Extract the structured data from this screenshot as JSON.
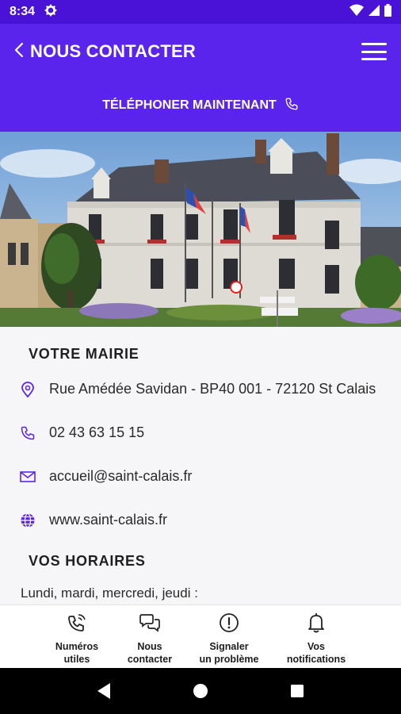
{
  "status_bar": {
    "time": "8:34"
  },
  "header": {
    "title": "NOUS CONTACTER"
  },
  "call_bar": {
    "label": "TÉLÉPHONER MAINTENANT"
  },
  "mairie": {
    "title": "VOTRE MAIRIE",
    "address": "Rue Amédée Savidan - BP40 001 - 72120 St Calais",
    "phone": "02 43 63 15 15",
    "email": "accueil@saint-calais.fr",
    "website": "www.saint-calais.fr"
  },
  "hours": {
    "title": "VOS HORAIRES",
    "first_line": "Lundi, mardi, mercredi, jeudi :"
  },
  "bottom_nav": {
    "items": [
      {
        "line1": "Numéros",
        "line2": "utiles",
        "icon": "phone-ring-icon"
      },
      {
        "line1": "Nous",
        "line2": "contacter",
        "icon": "chat-bubbles-icon"
      },
      {
        "line1": "Signaler",
        "line2": "un problème",
        "icon": "alert-circle-icon"
      },
      {
        "line1": "Vos",
        "line2": "notifications",
        "icon": "bell-icon"
      }
    ]
  },
  "colors": {
    "primary": "#5a24ec",
    "status_bar": "#4a12d6",
    "icon_accent": "#5a24ec"
  }
}
